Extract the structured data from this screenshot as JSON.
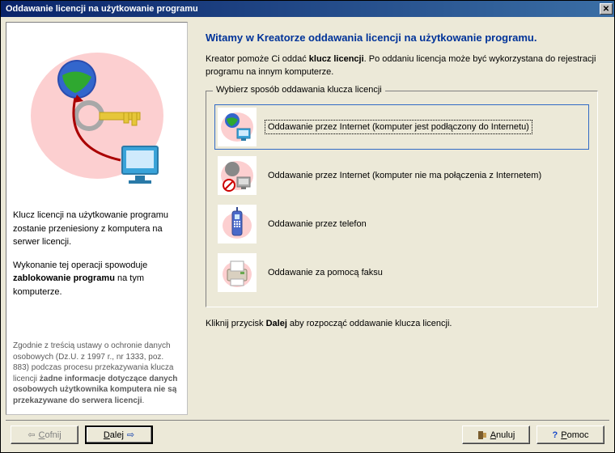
{
  "window": {
    "title": "Oddawanie licencji na użytkowanie programu"
  },
  "left": {
    "text1": "Klucz licencji na użytkowanie programu zostanie przeniesiony z komputera na serwer licencji.",
    "text2_a": "Wykonanie tej operacji spowoduje ",
    "text2_b": "zablokowanie programu",
    "text2_c": " na tym komputerze.",
    "privacy_a": "Zgodnie z treścią ustawy o ochronie danych osobowych (Dz.U. z 1997 r., nr 1333, poz. 883) podczas procesu przekazywania klucza licencji ",
    "privacy_b": "żadne informacje dotyczące danych osobowych użytkownika komputera nie są przekazywane do serwera licencji",
    "privacy_c": "."
  },
  "right": {
    "title": "Witamy w Kreatorze oddawania licencji na użytkowanie programu.",
    "intro_a": "Kreator pomoże Ci oddać ",
    "intro_b": "klucz licencji",
    "intro_c": ". Po oddaniu licencja może być wykorzystana do rejestracji programu na innym komputerze.",
    "group_title": "Wybierz sposób oddawania klucza licencji",
    "options": [
      {
        "label": "Oddawanie przez Internet (komputer jest podłączony do Internetu)",
        "selected": true
      },
      {
        "label": "Oddawanie przez Internet (komputer nie ma połączenia z Internetem)",
        "selected": false
      },
      {
        "label": "Oddawanie przez telefon",
        "selected": false
      },
      {
        "label": "Oddawanie za pomocą faksu",
        "selected": false
      }
    ],
    "hint_a": "Kliknij przycisk ",
    "hint_b": "Dalej",
    "hint_c": " aby rozpocząć oddawanie klucza licencji."
  },
  "buttons": {
    "back": "Cofnij",
    "next": "Dalej",
    "cancel": "Anuluj",
    "help": "Pomoc"
  }
}
